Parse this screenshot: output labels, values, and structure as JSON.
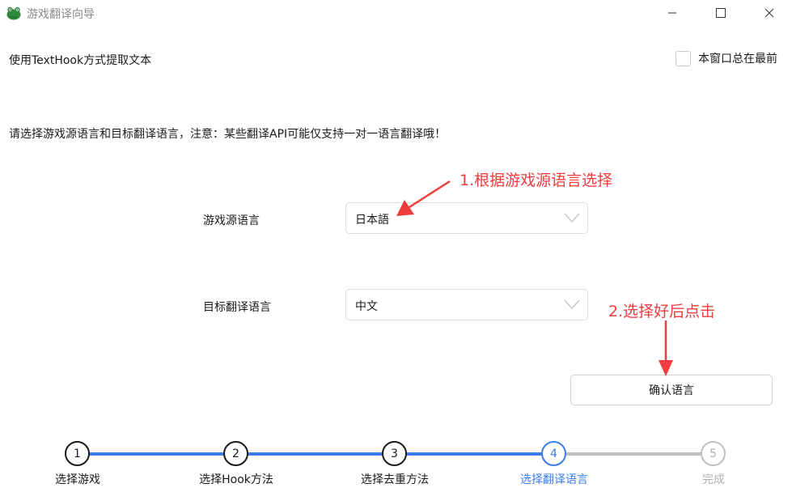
{
  "window": {
    "title": "游戏翻译向导",
    "icon": "frog-app-icon",
    "controls": [
      "minimize-icon",
      "maximize-icon",
      "close-icon"
    ]
  },
  "header": {
    "hook_method": "使用TextHook方式提取文本",
    "always_on_top": {
      "label": "本窗口总在最前",
      "checked": false
    }
  },
  "instruction": "请选择游戏源语言和目标翻译语言，注意：某些翻译API可能仅支持一对一语言翻译哦！",
  "source_language": {
    "label": "游戏源语言",
    "value": "日本語"
  },
  "target_language": {
    "label": "目标翻译语言",
    "value": "中文"
  },
  "confirm_button": "确认语言",
  "annotations": {
    "note1": "1.根据游戏源语言选择",
    "note2": "2.选择好后点击",
    "color": "#ef3d3d"
  },
  "steps": [
    {
      "number": "1",
      "label": "选择游戏",
      "state": "done"
    },
    {
      "number": "2",
      "label": "选择Hook方法",
      "state": "done"
    },
    {
      "number": "3",
      "label": "选择去重方法",
      "state": "done"
    },
    {
      "number": "4",
      "label": "选择翻译语言",
      "state": "active"
    },
    {
      "number": "5",
      "label": "完成",
      "state": "pending"
    }
  ],
  "colors": {
    "accent": "#3b7ded",
    "pending": "#c0c0c0"
  }
}
